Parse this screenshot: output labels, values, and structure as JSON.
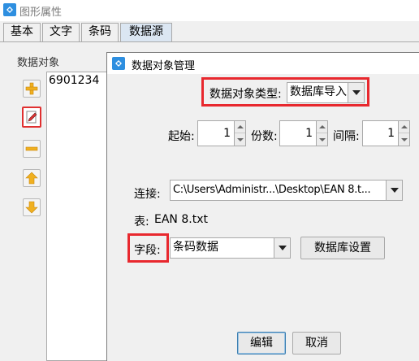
{
  "window": {
    "title": "图形属性"
  },
  "tabs": [
    {
      "label": "基本"
    },
    {
      "label": "文字"
    },
    {
      "label": "条码"
    },
    {
      "label": "数据源"
    }
  ],
  "data_objects": {
    "group_label": "数据对象",
    "items": [
      "6901234"
    ]
  },
  "dialog": {
    "title": "数据对象管理",
    "type_label": "数据对象类型:",
    "type_value": "数据库导入",
    "start_label": "起始:",
    "start_value": "1",
    "copies_label": "份数:",
    "copies_value": "1",
    "interval_label": "间隔:",
    "interval_value": "1",
    "connection_label": "连接:",
    "connection_value": "C:\\Users\\Administr...\\Desktop\\EAN 8.t...",
    "table_label": "表:",
    "table_value": "EAN 8.txt",
    "field_label": "字段:",
    "field_value": "条码数据",
    "db_settings_label": "数据库设置",
    "edit_label": "编辑",
    "cancel_label": "取消"
  },
  "colors": {
    "highlight": "#e8282e",
    "accent": "#3c7fb1"
  }
}
